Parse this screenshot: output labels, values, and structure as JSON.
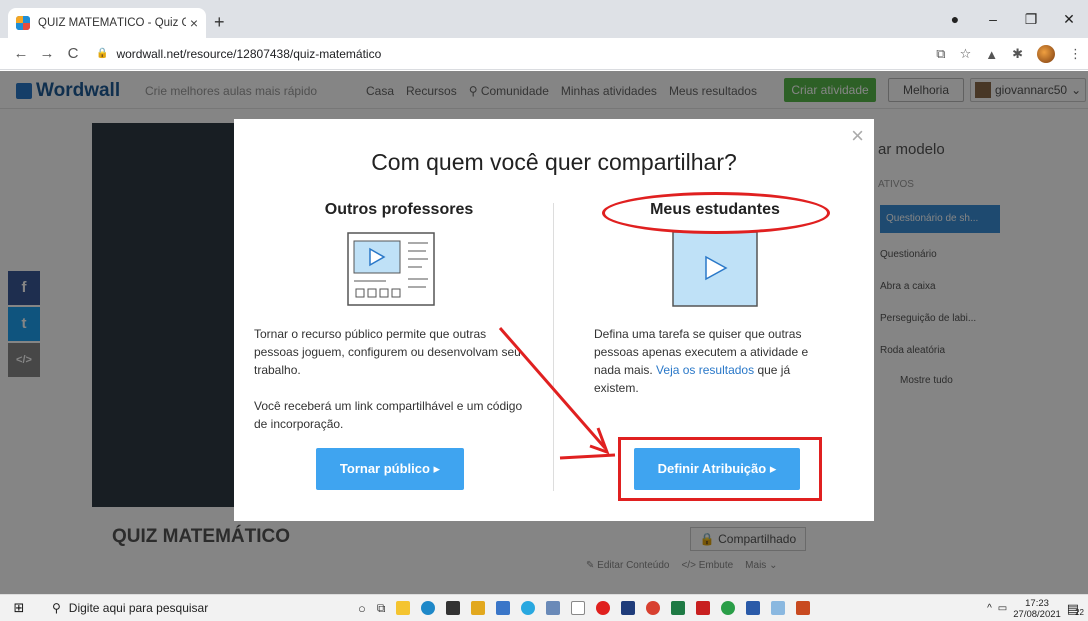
{
  "browser": {
    "tab_title": "QUIZ MATEMÁTICO - Quiz Game",
    "tab_close": "×",
    "new_tab": "+",
    "back": "←",
    "forward": "→",
    "reload": "C",
    "url": "wordwall.net/resource/12807438/quiz-matemático",
    "win_minimize": "–",
    "win_restore": "❐",
    "win_close": "✕"
  },
  "site": {
    "logo": "Wordwall",
    "tagline": "Crie melhores aulas mais rápido",
    "nav": [
      "Casa",
      "Recursos",
      "Comunidade",
      "Minhas atividades",
      "Meus resultados"
    ],
    "create_label": "Criar atividade",
    "upgrade_label": "Melhoria",
    "user_name": "giovannarc50"
  },
  "right_panel": {
    "title": "ar modelo",
    "subtitle": "ATIVOS",
    "items": [
      "Questionário de sh...",
      "Questionário",
      "Abra a caixa",
      "Perseguição de labi...",
      "Roda aleatória",
      "Mostre tudo"
    ]
  },
  "social": {
    "facebook": "f",
    "twitter": "t",
    "embed": "</>"
  },
  "activity": {
    "title": "QUIZ MATEMÁTICO",
    "shared_label": "Compartilhado",
    "edit_label": "Editar Conteúdo",
    "embed_label": "Embute",
    "more_label": "Mais"
  },
  "modal": {
    "close": "×",
    "title": "Com quem você quer compartilhar?",
    "left": {
      "heading": "Outros professores",
      "text1": "Tornar o recurso público permite que outras pessoas joguem, configurem ou desenvolvam seu trabalho.",
      "text2": "Você receberá um link compartilhável e um código de incorporação.",
      "button": "Tornar público ▸"
    },
    "right": {
      "heading": "Meus estudantes",
      "text_before": "Defina uma tarefa se quiser que outras pessoas apenas executem a atividade e nada mais.",
      "link": "Veja os resultados",
      "text_after": "que já existem.",
      "button": "Definir Atribuição ▸"
    }
  },
  "taskbar": {
    "search_placeholder": "Digite aqui para pesquisar",
    "time": "17:23",
    "date": "27/08/2021",
    "notif_count": "22"
  },
  "colors": {
    "accent_blue": "#3fa4f0",
    "annotation_red": "#e02020",
    "create_green": "#57b94a"
  }
}
